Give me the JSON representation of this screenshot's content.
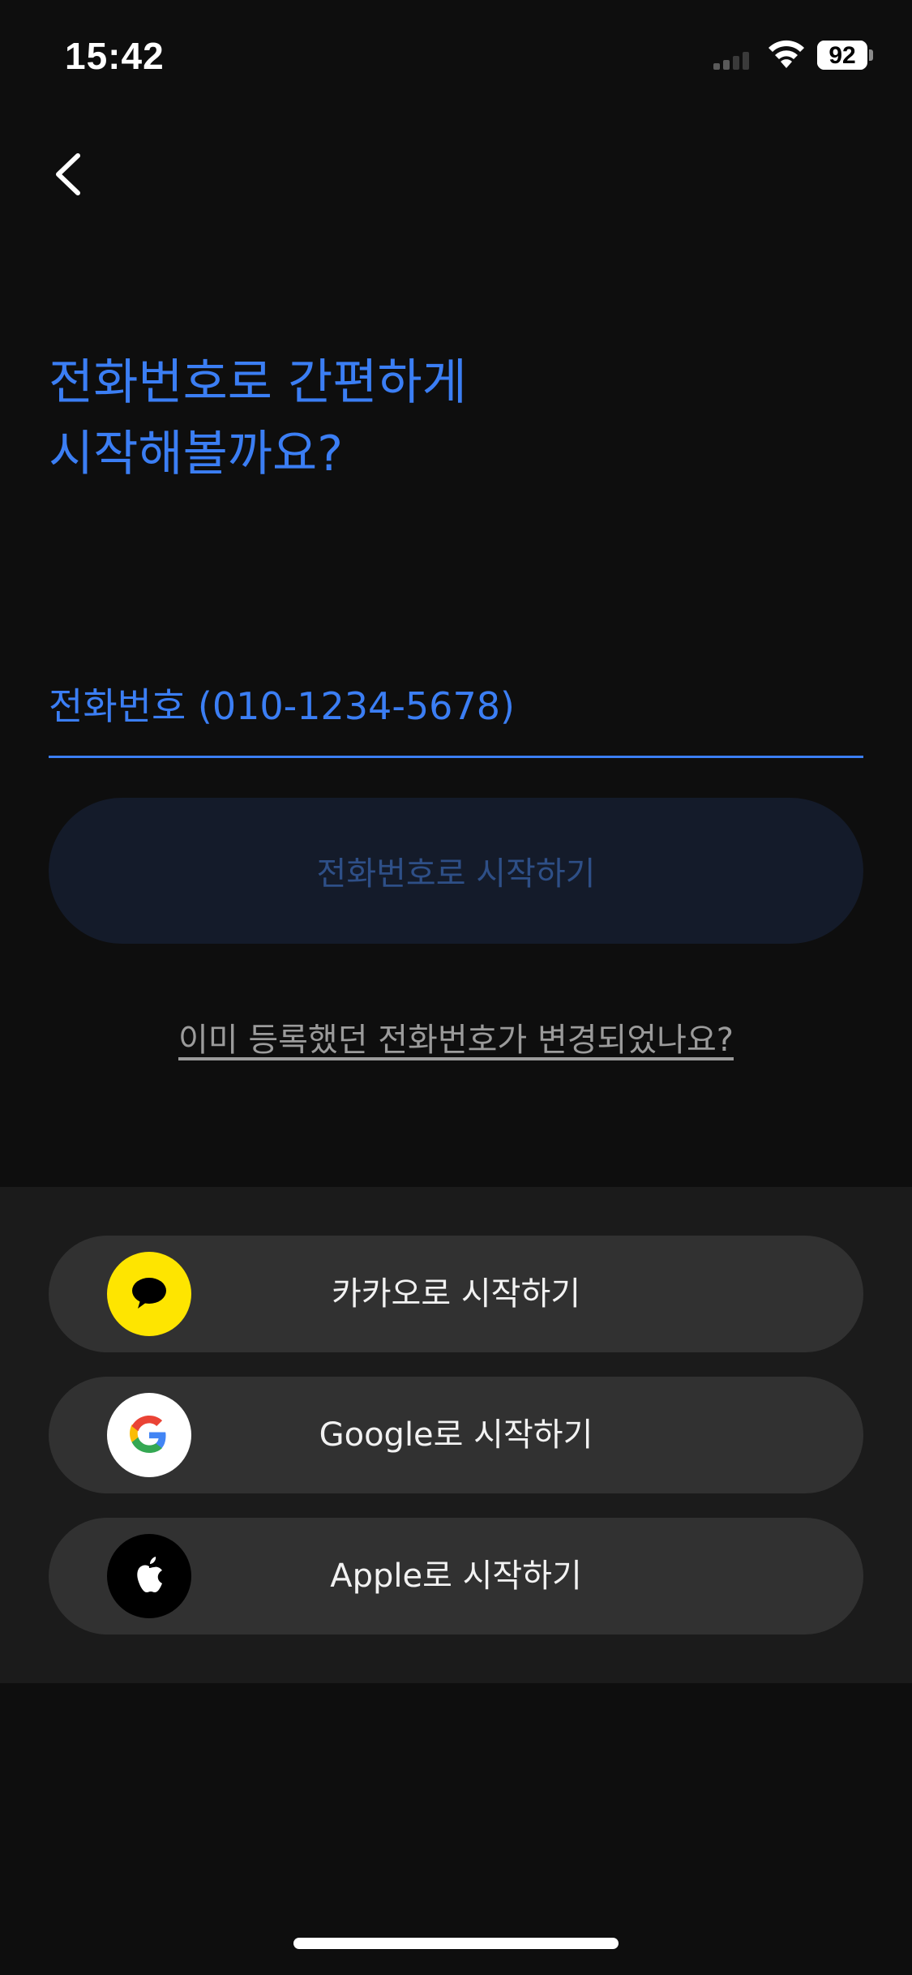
{
  "status_bar": {
    "time": "15:42",
    "battery_percent": "92",
    "battery_level": 0.92
  },
  "header": {
    "back_icon": "chevron-left-icon"
  },
  "headline": {
    "line1": "전화번호로 간편하게",
    "line2": "시작해볼까요?"
  },
  "phone_form": {
    "placeholder": "전화번호 (010-1234-5678)",
    "value": "",
    "submit_label": "전화번호로 시작하기",
    "submit_enabled": false,
    "changed_number_link": "이미 등록했던 전화번호가 변경되었나요?"
  },
  "social_login": {
    "buttons": [
      {
        "label": "카카오로 시작하기",
        "icon": "kakao-talk-icon",
        "icon_bg": "#fee500"
      },
      {
        "label": "Google로 시작하기",
        "icon": "google-icon",
        "icon_bg": "#ffffff"
      },
      {
        "label": "Apple로 시작하기",
        "icon": "apple-icon",
        "icon_bg": "#000000"
      }
    ]
  },
  "colors": {
    "accent": "#3b7ef4",
    "background": "#0e0e0e",
    "panel": "#1b1b1b",
    "button": "#313131",
    "disabled_button": "#141b2a",
    "disabled_text": "#2e4f87"
  }
}
